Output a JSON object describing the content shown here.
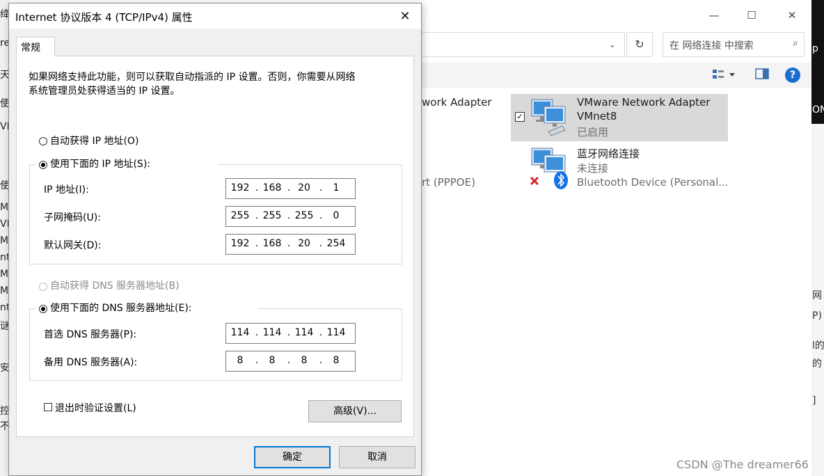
{
  "dialog": {
    "title": "Internet 协议版本 4 (TCP/IPv4) 属性",
    "close_symbol": "✕",
    "tab_general": "常规",
    "intro_line1": "如果网络支持此功能，则可以获取自动指派的 IP 设置。否则，你需要从网络",
    "intro_line2": "系统管理员处获得适当的 IP 设置。",
    "radio_auto_ip": "自动获得 IP 地址(O)",
    "radio_manual_ip": "使用下面的 IP 地址(S):",
    "ip_label": "IP 地址(I):",
    "ip": [
      "192",
      "168",
      "20",
      "1"
    ],
    "mask_label": "子网掩码(U):",
    "mask": [
      "255",
      "255",
      "255",
      "0"
    ],
    "gateway_label": "默认网关(D):",
    "gateway": [
      "192",
      "168",
      "20",
      "254"
    ],
    "radio_auto_dns": "自动获得 DNS 服务器地址(B)",
    "radio_manual_dns": "使用下面的 DNS 服务器地址(E):",
    "dns1_label": "首选 DNS 服务器(P):",
    "dns1": [
      "114",
      "114",
      "114",
      "114"
    ],
    "dns2_label": "备用 DNS 服务器(A):",
    "dns2": [
      "8",
      "8",
      "8",
      "8"
    ],
    "validate_label": "退出时验证设置(L)",
    "advanced_button": "高级(V)...",
    "ok_button": "确定",
    "cancel_button": "取消",
    "selected_ip_mode": "manual",
    "selected_dns_mode": "manual",
    "validate_checked": false
  },
  "explorer": {
    "min_symbol": "—",
    "max_symbol": "☐",
    "close_symbol": "✕",
    "chevron_symbol": "⌄",
    "refresh_symbol": "↻",
    "search_placeholder": "在 网络连接 中搜索",
    "search_symbol": "⌕",
    "frag_adapter": "work Adapter",
    "frag_pppoe": "rt (PPPOE)",
    "item1_name": "VMware Network Adapter",
    "item1_name2": "VMnet8",
    "item1_status": "已启用",
    "item1_check": "✓",
    "item2_name": "蓝牙网络连接",
    "item2_status": "未连接",
    "item2_device": "Bluetooth Device (Personal...",
    "help_symbol": "?",
    "accent": "#1a6ecf"
  },
  "edges": {
    "left": [
      "绛",
      "re",
      "天看",
      "使用",
      "VI",
      "使用",
      "Mi",
      "VM",
      "Mi",
      "nt",
      "Mi",
      "Mi",
      "nt",
      "谜",
      "安装",
      "控",
      "不"
    ],
    "right": [
      "p",
      "ON",
      "网",
      "P)",
      "l的",
      "的",
      "]"
    ]
  },
  "watermark": "CSDN @The dreamer66"
}
